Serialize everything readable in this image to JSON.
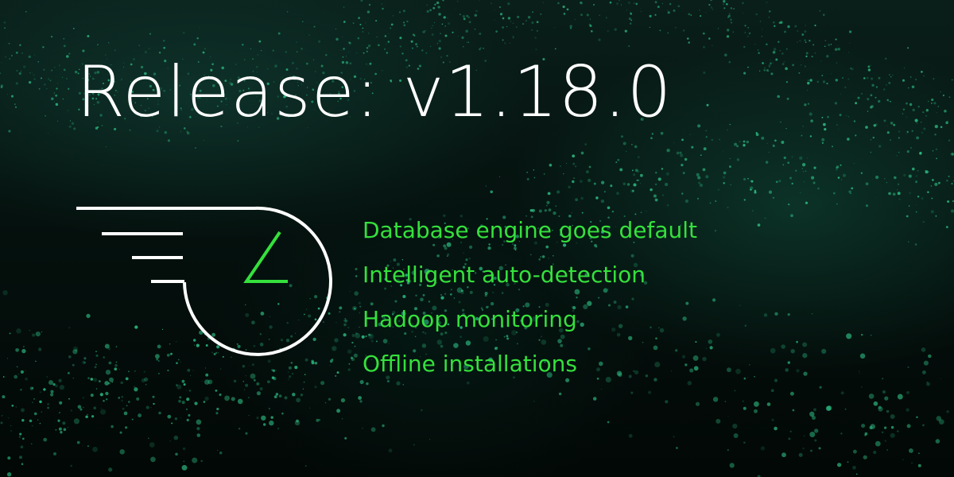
{
  "headline": "Release: v1.18.0",
  "features": [
    "Database engine goes default",
    "Intelligent auto-detection",
    "Hadoop monitoring",
    "Offline installations"
  ],
  "logo": {
    "icon": "speedometer-gauge-icon",
    "outline_color": "#ffffff",
    "needle_color": "#35e03c"
  },
  "colors": {
    "background": "#030806",
    "headline": "#ffffff",
    "feature_text": "#35e03c",
    "particles": "#2fc68a"
  }
}
